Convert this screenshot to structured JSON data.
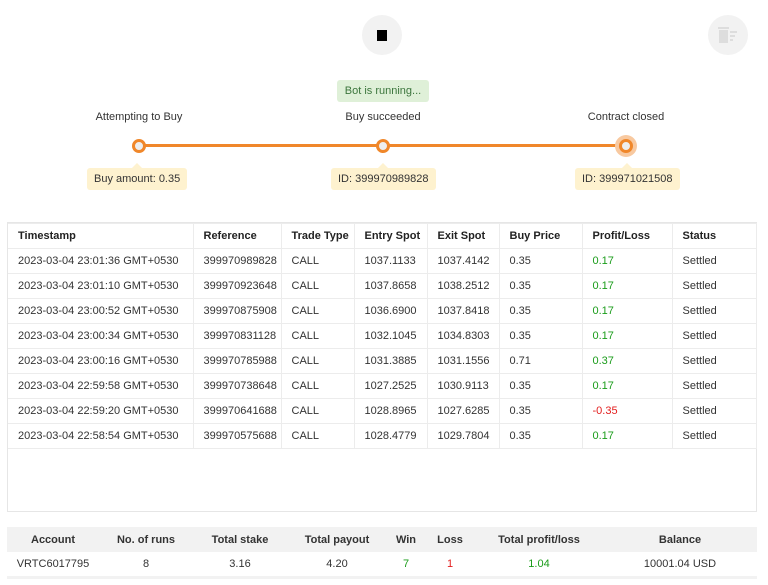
{
  "controls": {
    "stop_icon": "stop-icon",
    "clear_icon": "trash-icon"
  },
  "status": "Bot is running...",
  "steps": [
    {
      "label": "Attempting to Buy",
      "info": "Buy amount: 0.35"
    },
    {
      "label": "Buy succeeded",
      "info": "ID: 399970989828"
    },
    {
      "label": "Contract closed",
      "info": "ID: 399971021508"
    }
  ],
  "table": {
    "headers": [
      "Timestamp",
      "Reference",
      "Trade Type",
      "Entry Spot",
      "Exit Spot",
      "Buy Price",
      "Profit/Loss",
      "Status"
    ],
    "rows": [
      [
        "2023-03-04 23:01:36 GMT+0530",
        "399970989828",
        "CALL",
        "1037.1133",
        "1037.4142",
        "0.35",
        "0.17",
        "Settled"
      ],
      [
        "2023-03-04 23:01:10 GMT+0530",
        "399970923648",
        "CALL",
        "1037.8658",
        "1038.2512",
        "0.35",
        "0.17",
        "Settled"
      ],
      [
        "2023-03-04 23:00:52 GMT+0530",
        "399970875908",
        "CALL",
        "1036.6900",
        "1037.8418",
        "0.35",
        "0.17",
        "Settled"
      ],
      [
        "2023-03-04 23:00:34 GMT+0530",
        "399970831128",
        "CALL",
        "1032.1045",
        "1034.8303",
        "0.35",
        "0.17",
        "Settled"
      ],
      [
        "2023-03-04 23:00:16 GMT+0530",
        "399970785988",
        "CALL",
        "1031.3885",
        "1031.1556",
        "0.71",
        "0.37",
        "Settled"
      ],
      [
        "2023-03-04 22:59:58 GMT+0530",
        "399970738648",
        "CALL",
        "1027.2525",
        "1030.9113",
        "0.35",
        "0.17",
        "Settled"
      ],
      [
        "2023-03-04 22:59:20 GMT+0530",
        "399970641688",
        "CALL",
        "1028.8965",
        "1027.6285",
        "0.35",
        "-0.35",
        "Settled"
      ],
      [
        "2023-03-04 22:58:54 GMT+0530",
        "399970575688",
        "CALL",
        "1028.4779",
        "1029.7804",
        "0.35",
        "0.17",
        "Settled"
      ]
    ]
  },
  "summary": {
    "headers": [
      "Account",
      "No. of runs",
      "Total stake",
      "Total payout",
      "Win",
      "Loss",
      "Total profit/loss",
      "Balance"
    ],
    "values": [
      "VRTC6017795",
      "8",
      "3.16",
      "4.20",
      "7",
      "1",
      "1.04",
      "10001.04 USD"
    ]
  },
  "colors": {
    "accent": "#f0872a",
    "profit": "#1a9c1a",
    "loss": "#e31c1c"
  }
}
